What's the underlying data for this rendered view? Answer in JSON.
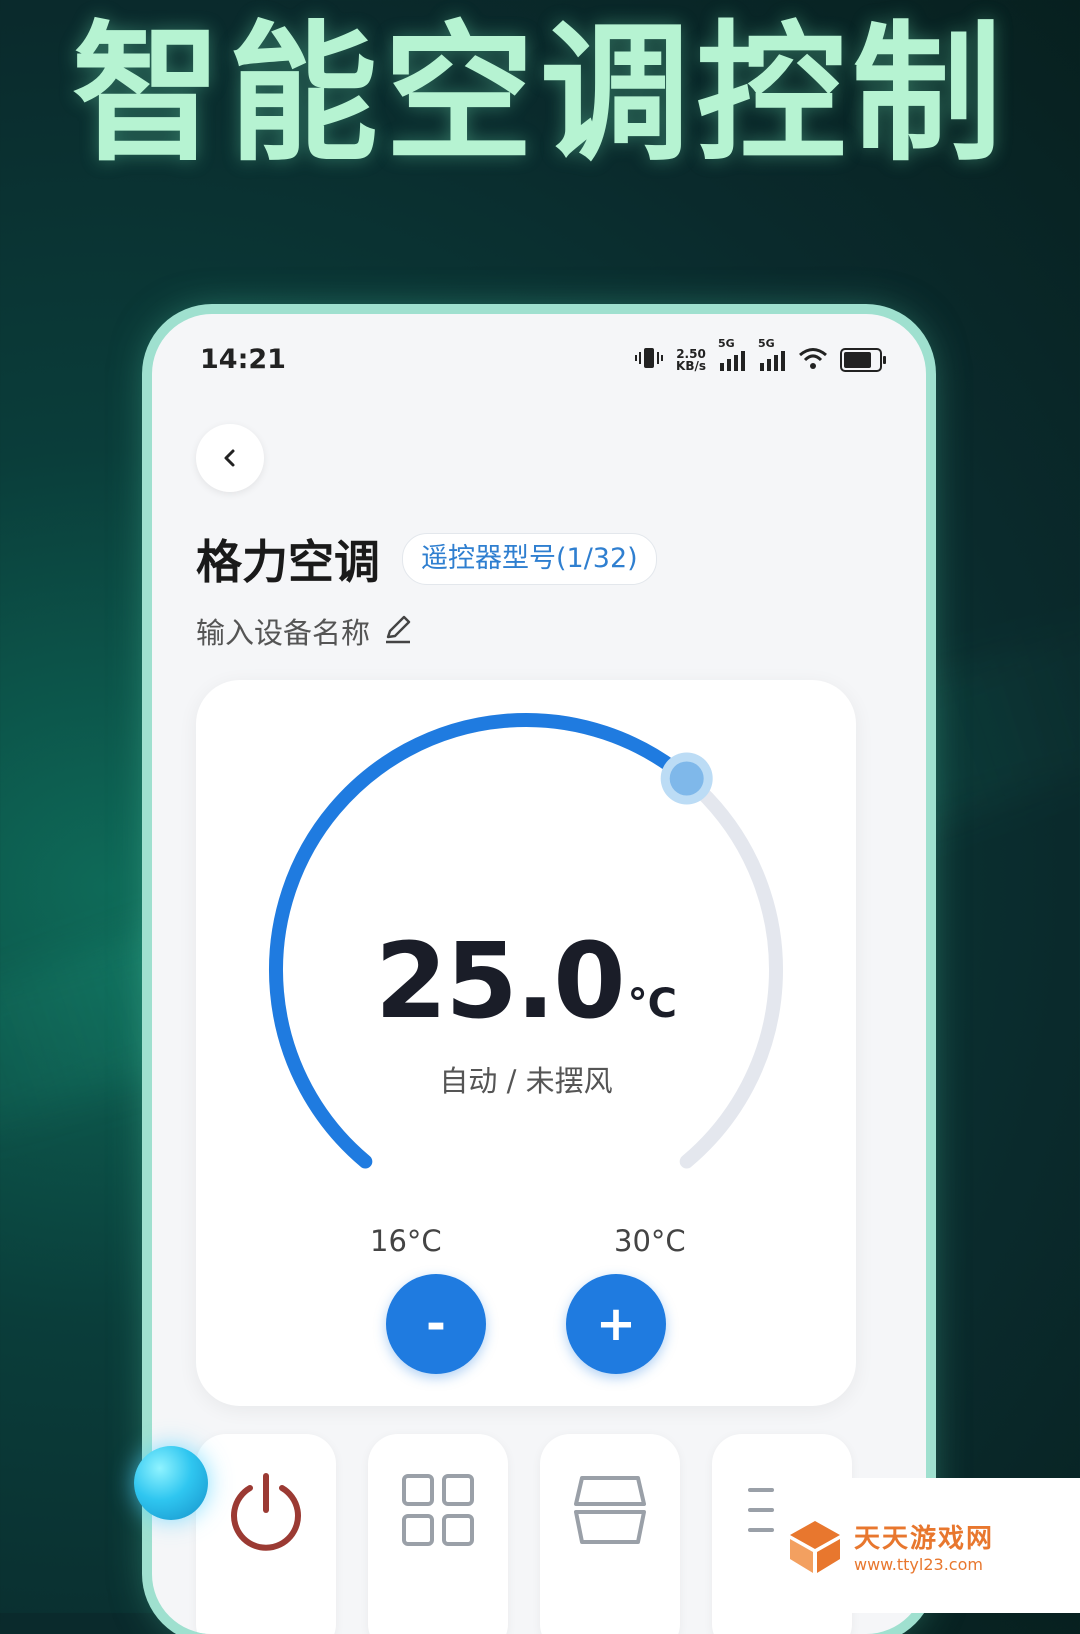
{
  "headline": "智能空调控制",
  "status_bar": {
    "time": "14:21",
    "net_speed_value": "2.50",
    "net_speed_unit": "KB/s",
    "signal_1_label": "5G",
    "signal_2_label": "5G"
  },
  "header": {
    "device_title": "格力空调",
    "remote_model_label": "遥控器型号(1/32)",
    "device_name_placeholder": "输入设备名称"
  },
  "thermostat": {
    "temperature": "25.0",
    "unit": "°C",
    "mode_status": "自动 / 未摆风",
    "min_label": "16°C",
    "max_label": "30°C",
    "min_value": 16,
    "max_value": 30,
    "current_value": 25.0,
    "decrease_label": "-",
    "increase_label": "+"
  },
  "function_tiles": [
    {
      "icon": "power-icon",
      "color": "#9b3a33"
    },
    {
      "icon": "grid-icon",
      "color": "#9aa0a8"
    },
    {
      "icon": "layers-icon",
      "color": "#9aa0a8"
    },
    {
      "icon": "list-icon",
      "color": "#9aa0a8"
    }
  ],
  "watermark": {
    "name": "天天游戏网",
    "url": "www.ttyl23.com"
  },
  "colors": {
    "accent": "#1f7be0",
    "headline": "#b6f3d2",
    "track": "#e4e7ee"
  }
}
